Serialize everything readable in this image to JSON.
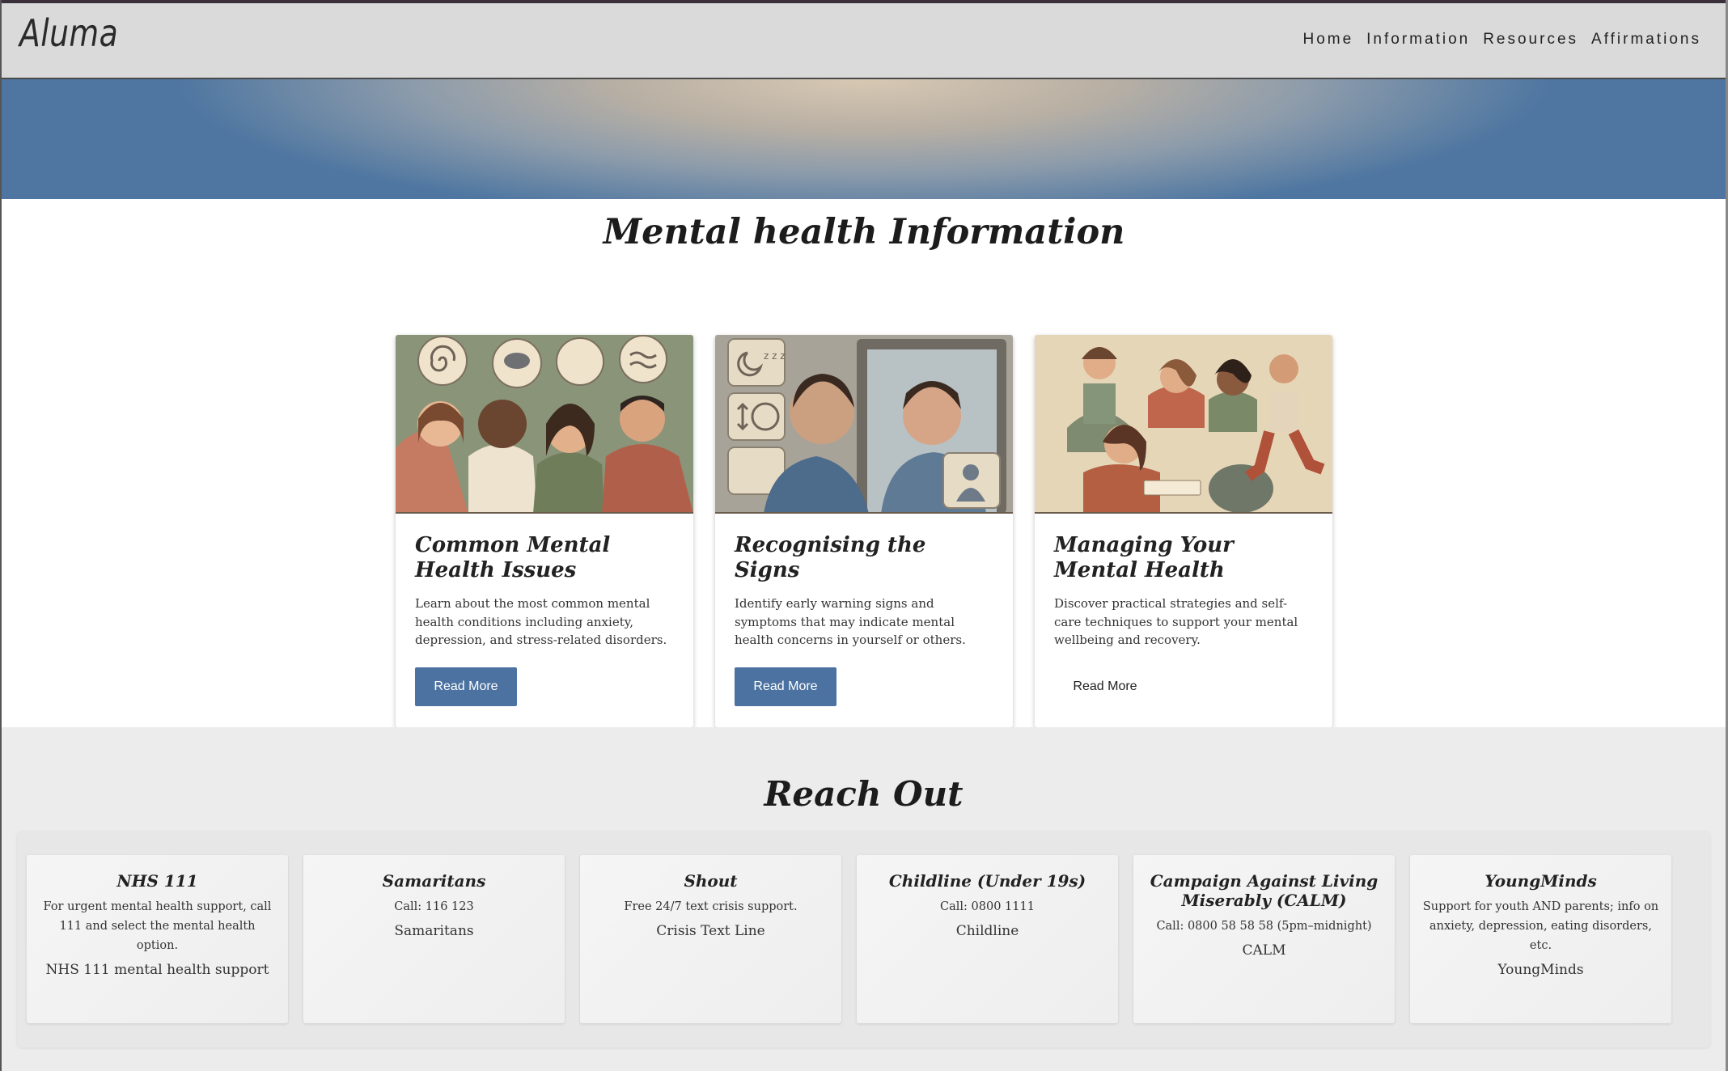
{
  "header": {
    "logo": "Aluma",
    "nav": [
      "Home",
      "Information",
      "Resources",
      "Affirmations"
    ]
  },
  "info": {
    "title": "Mental health Information",
    "cards": [
      {
        "title": "Common Mental Health Issues",
        "text": "Learn about the most common mental health conditions including anxiety, depression, and stress-related disorders.",
        "button": "Read More"
      },
      {
        "title": "Recognising the Signs",
        "text": "Identify early warning signs and symptoms that may indicate mental health concerns in yourself or others.",
        "button": "Read More"
      },
      {
        "title": "Managing Your Mental Health",
        "text": "Discover practical strategies and self-care techniques to support your mental wellbeing and recovery.",
        "button": "Read More"
      }
    ]
  },
  "reach": {
    "title": "Reach Out",
    "contacts": [
      {
        "name": "NHS 111",
        "desc": "For urgent mental health support, call 111 and select the mental health option.",
        "link": "NHS 111 mental health support"
      },
      {
        "name": "Samaritans",
        "desc": "Call: 116 123",
        "link": "Samaritans"
      },
      {
        "name": "Shout",
        "desc": "Free 24/7 text crisis support.",
        "link": "Crisis Text Line"
      },
      {
        "name": "Childline (Under 19s)",
        "desc": "Call: 0800 1111",
        "link": "Childline"
      },
      {
        "name": "Campaign Against Living Miserably (CALM)",
        "desc": "Call: 0800 58 58 58 (5pm–midnight)",
        "link": "CALM"
      },
      {
        "name": "YoungMinds",
        "desc": "Support for youth AND parents; info on anxiety, depression, eating disorders, etc.",
        "link": "YoungMinds"
      }
    ]
  },
  "colors": {
    "accent": "#4b72a0",
    "header_bg": "#dadada",
    "reach_bg": "#ececec"
  }
}
